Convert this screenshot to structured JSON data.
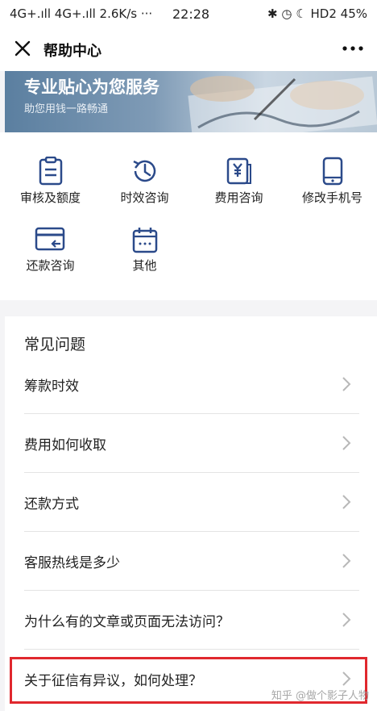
{
  "status_bar": {
    "left_text": "4G+ᵴᵴ 4G+ᵴᵴ 2.6K/s ···",
    "network_left": "4G+.ıll 4G+.ıll 2.6K/s ···",
    "time": "22:28",
    "right_text": "HD2 4G 45%",
    "battery": "45%"
  },
  "navbar": {
    "title": "帮助中心"
  },
  "banner": {
    "title": "专业贴心为您服务",
    "subtitle": "助您用钱一路畅通"
  },
  "shortcuts": [
    {
      "label": "审核及额度",
      "icon": "clipboard-icon"
    },
    {
      "label": "时效咨询",
      "icon": "clock-history-icon"
    },
    {
      "label": "费用咨询",
      "icon": "yen-document-icon"
    },
    {
      "label": "修改手机号",
      "icon": "mobile-phone-icon"
    },
    {
      "label": "还款咨询",
      "icon": "card-return-icon"
    },
    {
      "label": "其他",
      "icon": "calendar-icon"
    }
  ],
  "faq": {
    "heading": "常见问题",
    "items": [
      {
        "text": "筹款时效"
      },
      {
        "text": "费用如何收取"
      },
      {
        "text": "还款方式"
      },
      {
        "text": "客服热线是多少"
      },
      {
        "text": "为什么有的文章或页面无法访问？"
      },
      {
        "text": "关于征信有异议，如何处理？"
      }
    ]
  },
  "watermark": "知乎 @做个影子人物",
  "colors": {
    "icon_blue": "#2b4a8a",
    "highlight_red": "#e0282e",
    "divider": "#e4e4e4",
    "page_bg": "#f4f4f6"
  }
}
